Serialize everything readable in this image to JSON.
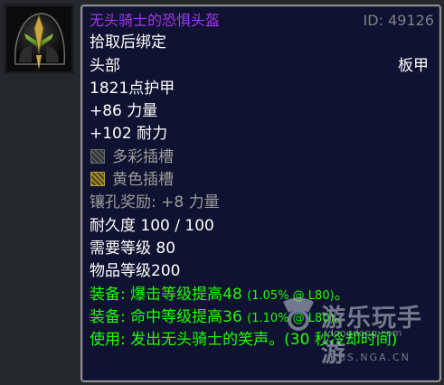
{
  "item": {
    "icon": "helmet-icon",
    "name": "无头骑士的恐惧头盔",
    "id_label": "ID: 49126",
    "binding": "拾取后绑定",
    "slot": "头部",
    "armor_type": "板甲",
    "armor": "1821点护甲",
    "stat1": "+86 力量",
    "stat2": "+102 耐力",
    "socket1": "多彩插槽",
    "socket2": "黄色插槽",
    "socket_bonus": "镶孔奖励: +8 力量",
    "durability": "耐久度 100 / 100",
    "required_level": "需要等级 80",
    "item_level": "物品等级200",
    "equip1": "装备: 爆击等级提高48",
    "equip1_pct": "(1.05% @ L80)",
    "equip1_tail": "。",
    "equip2": "装备: 命中等级提高36",
    "equip2_pct": "(1.10% @ L80)",
    "equip2_tail": "。",
    "use": "使用: 发出无头骑士的笑声。(30 秒冷却时间)"
  },
  "colors": {
    "epic": "#a335ee",
    "green": "#1eff00",
    "grey": "#9d9d9d",
    "background": "#0f1230"
  },
  "watermark": {
    "brand": "游乐玩手游",
    "site": "idongdong.com",
    "forum": "BBS.NGA.CN"
  }
}
